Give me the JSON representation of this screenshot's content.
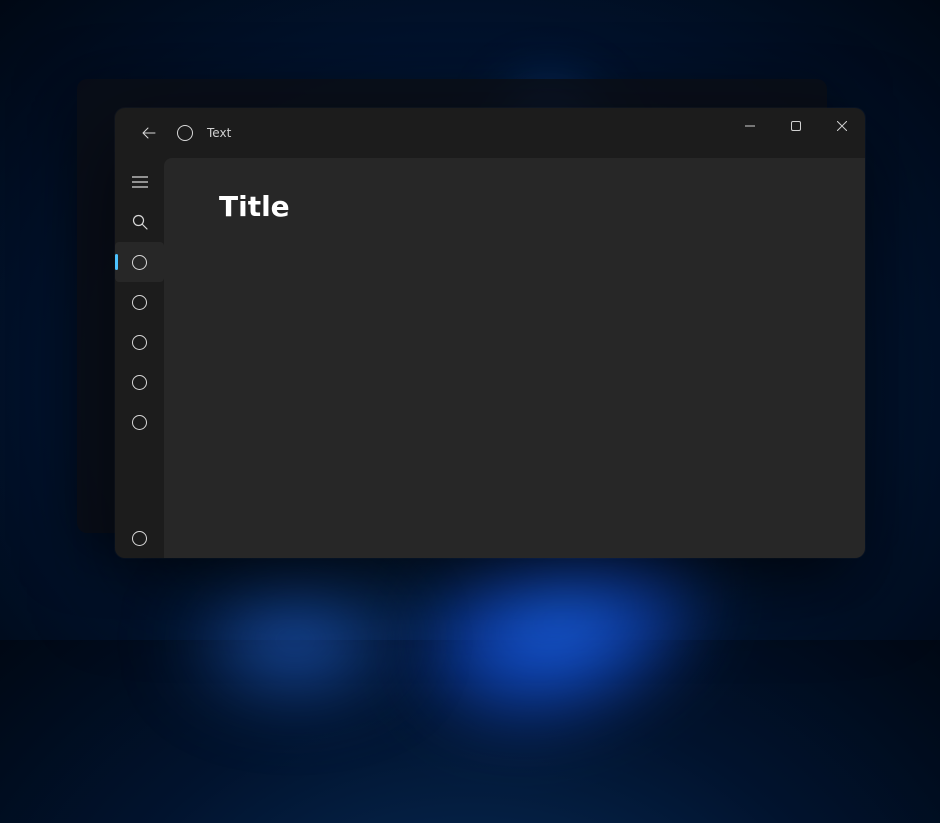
{
  "titlebar": {
    "app_title": "Text"
  },
  "content": {
    "title": "Title"
  },
  "sidebar": {
    "items": [
      {
        "selected": true
      },
      {
        "selected": false
      },
      {
        "selected": false
      },
      {
        "selected": false
      },
      {
        "selected": false
      }
    ]
  }
}
